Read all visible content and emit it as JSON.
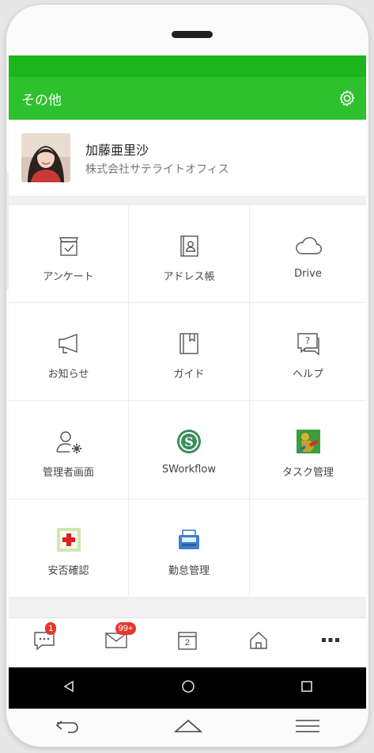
{
  "header": {
    "title": "その他",
    "settings_icon": "gear-icon"
  },
  "profile": {
    "name": "加藤亜里沙",
    "company": "株式会社サテライトオフィス"
  },
  "grid": {
    "items": [
      {
        "label": "アンケート",
        "icon": "survey-icon"
      },
      {
        "label": "アドレス帳",
        "icon": "address-book-icon"
      },
      {
        "label": "Drive",
        "icon": "cloud-icon"
      },
      {
        "label": "お知らせ",
        "icon": "megaphone-icon"
      },
      {
        "label": "ガイド",
        "icon": "book-icon"
      },
      {
        "label": "ヘルプ",
        "icon": "help-icon"
      },
      {
        "label": "管理者画面",
        "icon": "admin-icon"
      },
      {
        "label": "SWorkflow",
        "icon": "sworkflow-icon"
      },
      {
        "label": "タスク管理",
        "icon": "task-icon"
      },
      {
        "label": "安否確認",
        "icon": "safety-icon"
      },
      {
        "label": "勤怠管理",
        "icon": "attendance-icon"
      }
    ]
  },
  "tabbar": {
    "chat_badge": "1",
    "mail_badge": "99+",
    "calendar_day": "2"
  },
  "colors": {
    "header_green": "#2dc12d",
    "status_green": "#1cb51c",
    "badge_red": "#e8352d"
  }
}
